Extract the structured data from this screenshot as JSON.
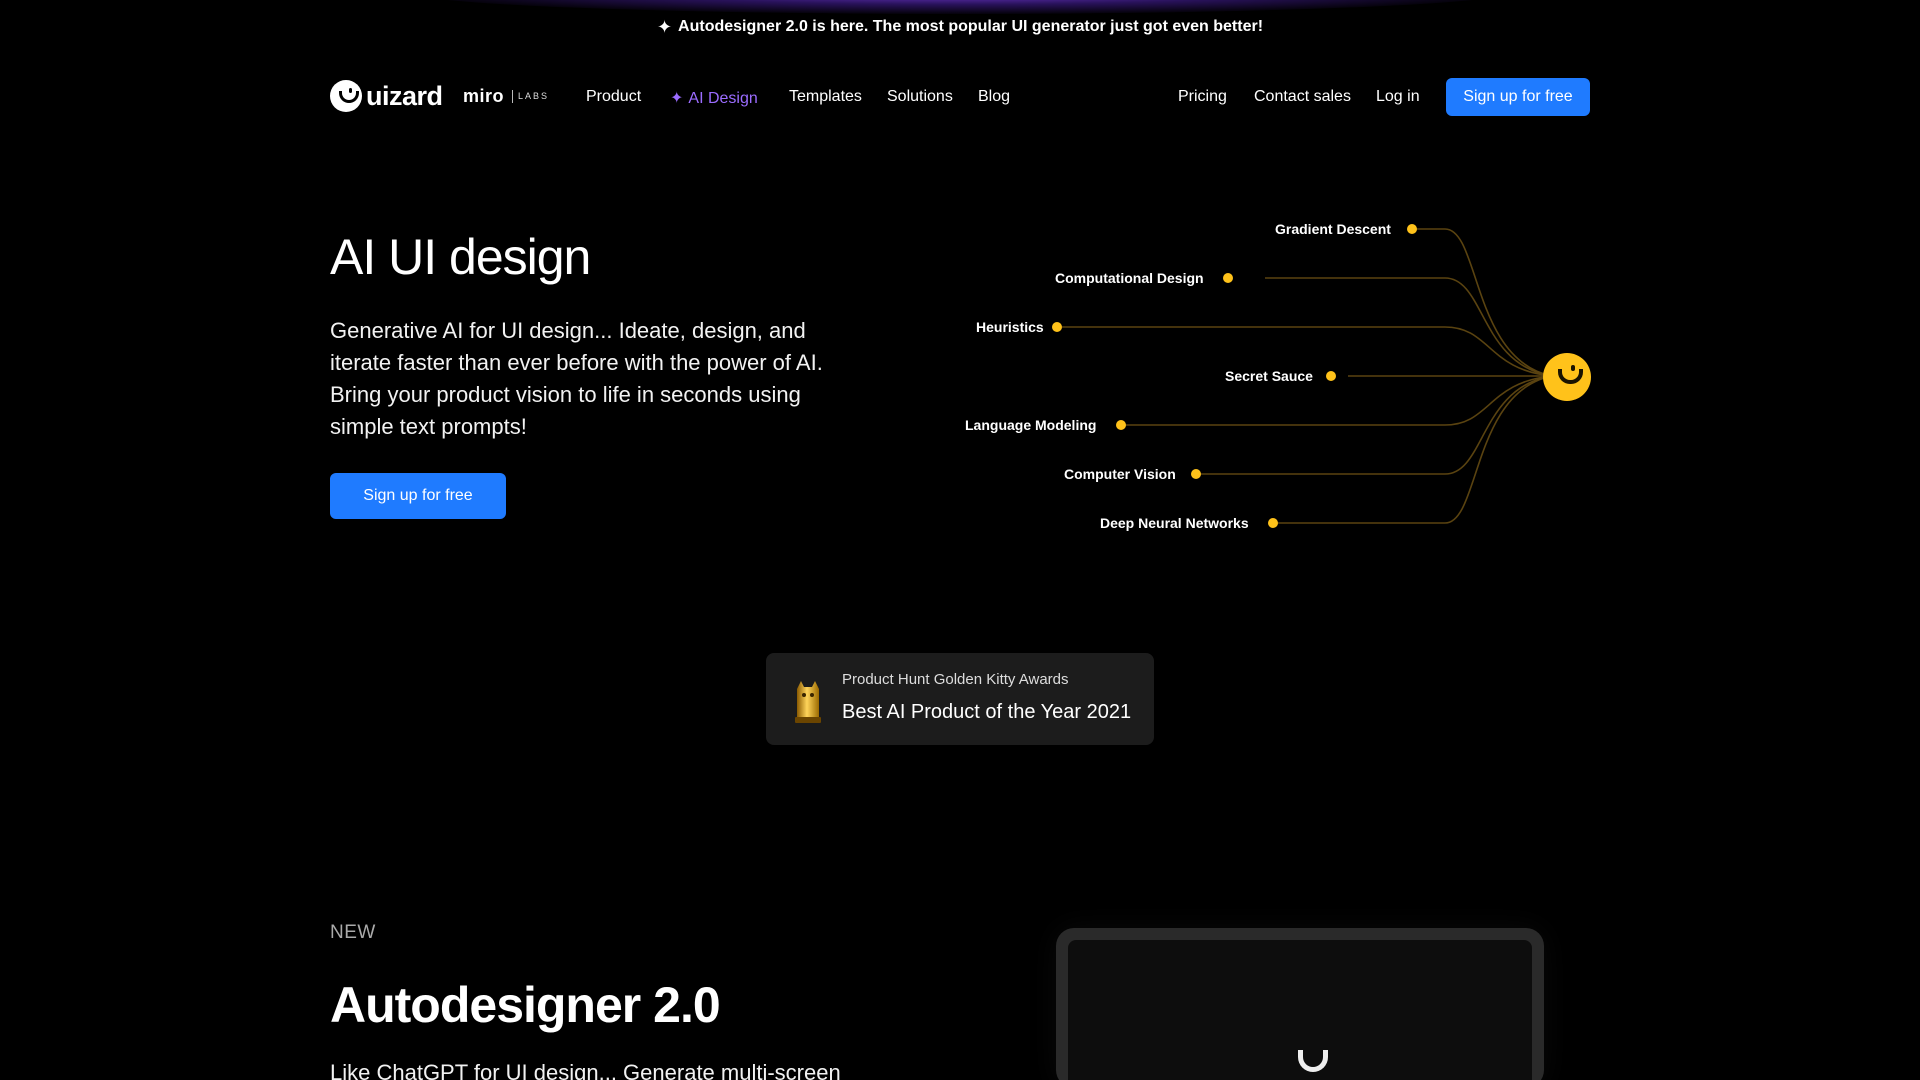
{
  "announcement": {
    "text": "Autodesigner 2.0 is here. The most popular UI generator just got even better!"
  },
  "brand": {
    "name": "uizard",
    "partner": "miro",
    "partner_suffix": "LABS"
  },
  "nav": {
    "links": [
      "Product",
      "AI Design",
      "Templates",
      "Solutions",
      "Blog"
    ],
    "right_links": [
      "Pricing",
      "Contact sales",
      "Log in"
    ],
    "cta": "Sign up for free"
  },
  "hero": {
    "title": "AI UI design",
    "body": "Generative AI for UI design... Ideate, design, and iterate faster than ever before with the power of AI. Bring your product vision to life in seconds using simple text prompts!",
    "cta": "Sign up for free"
  },
  "diagram": {
    "nodes": [
      "Gradient Descent",
      "Computational Design",
      "Heuristics",
      "Secret Sauce",
      "Language Modeling",
      "Computer Vision",
      "Deep Neural Networks"
    ],
    "accent_color": "#ffc21a"
  },
  "award": {
    "source": "Product Hunt Golden Kitty Awards",
    "title": "Best AI Product of the Year 2021"
  },
  "section": {
    "tag": "NEW",
    "title": "Autodesigner 2.0",
    "body": "Like ChatGPT for UI design... Generate multi-screen"
  },
  "colors": {
    "primary": "#1f7bff",
    "ai_purple": "#9b6cff",
    "background": "#000000"
  }
}
